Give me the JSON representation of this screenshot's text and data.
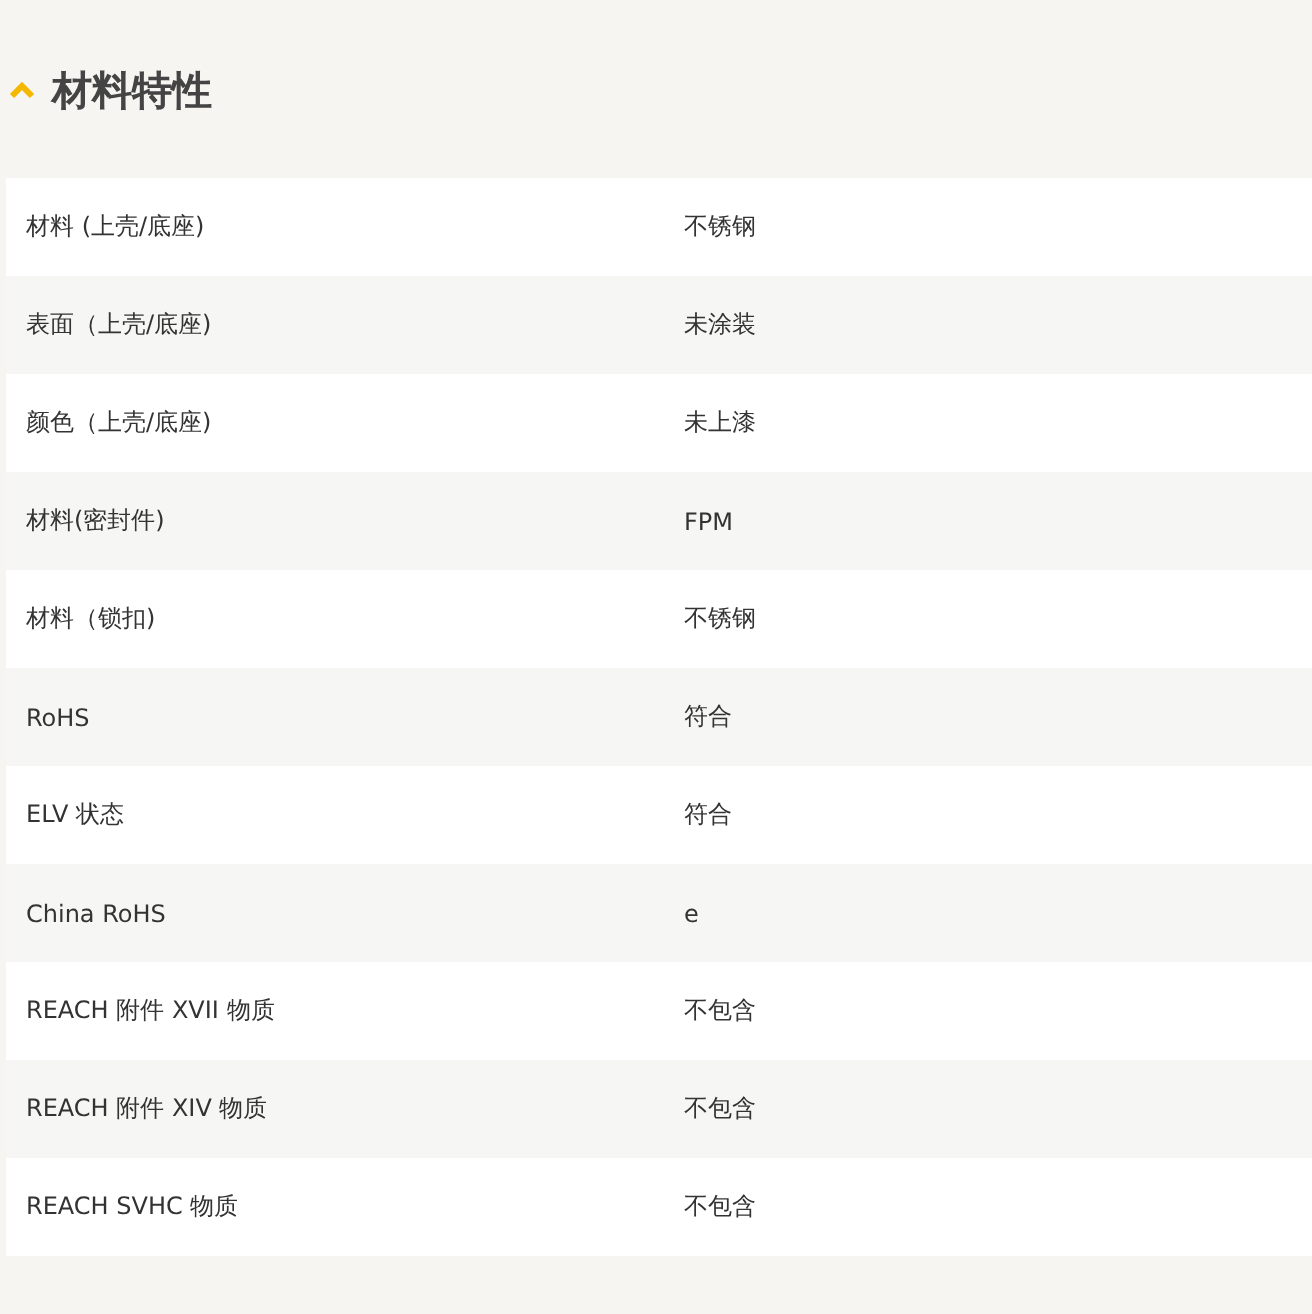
{
  "section": {
    "title": "材料特性",
    "expanded": true
  },
  "rows": [
    {
      "property": "材料 (上壳/底座)",
      "value": "不锈钢"
    },
    {
      "property": "表面（上壳/底座)",
      "value": "未涂装"
    },
    {
      "property": "颜色（上壳/底座)",
      "value": "未上漆"
    },
    {
      "property": "材料(密封件)",
      "value": "FPM"
    },
    {
      "property": "材料（锁扣)",
      "value": "不锈钢"
    },
    {
      "property": "RoHS",
      "value": "符合"
    },
    {
      "property": "ELV 状态",
      "value": "符合"
    },
    {
      "property": "China RoHS",
      "value": "e"
    },
    {
      "property": "REACH 附件 XVII 物质",
      "value": "不包含"
    },
    {
      "property": "REACH 附件 XIV 物质",
      "value": "不包含"
    },
    {
      "property": "REACH SVHC 物质",
      "value": "不包含"
    }
  ]
}
